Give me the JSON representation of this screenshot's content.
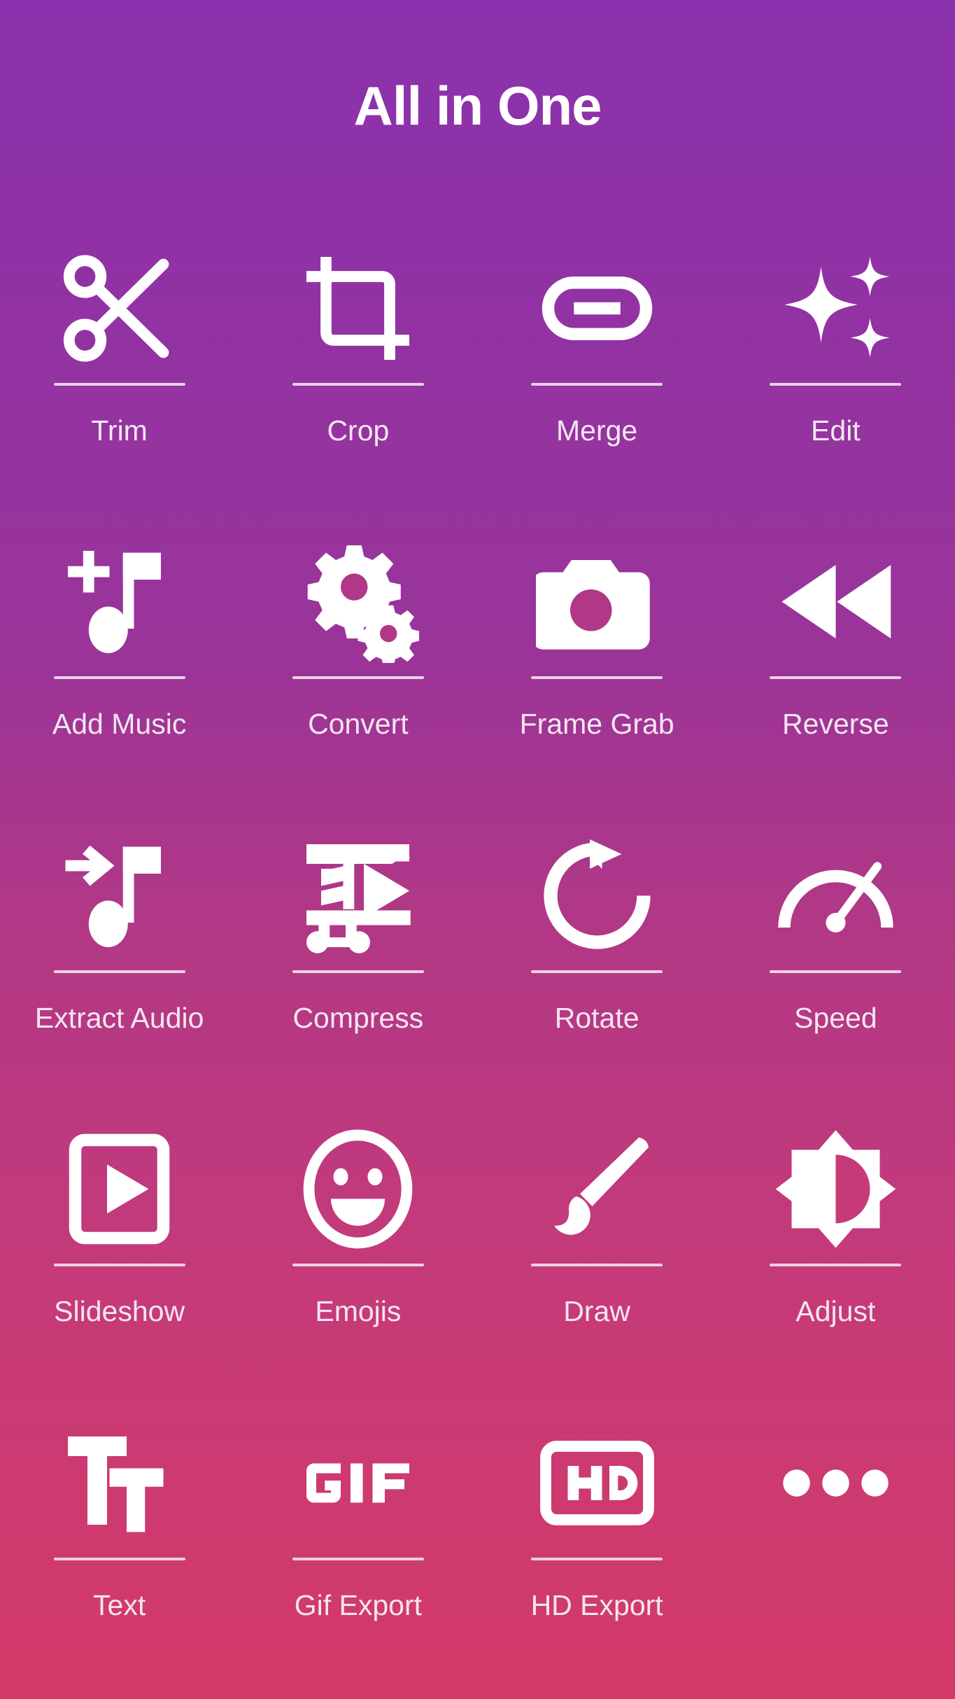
{
  "header": {
    "title": "All in One"
  },
  "theme": {
    "gradient_top": "#8a31ad",
    "gradient_bottom": "#d33a68",
    "icon_color": "#ffffff",
    "label_color": "#f4e6f1",
    "divider_color": "#ffffff"
  },
  "grid": {
    "columns": 4,
    "rows": 5,
    "items": [
      {
        "label": "Trim",
        "icon": "scissors-icon",
        "divider": true,
        "has_label": true
      },
      {
        "label": "Crop",
        "icon": "crop-icon",
        "divider": true,
        "has_label": true
      },
      {
        "label": "Merge",
        "icon": "link-chain-icon",
        "divider": true,
        "has_label": true
      },
      {
        "label": "Edit",
        "icon": "sparkles-icon",
        "divider": true,
        "has_label": true
      },
      {
        "label": "Add Music",
        "icon": "add-music-note-icon",
        "divider": true,
        "has_label": true
      },
      {
        "label": "Convert",
        "icon": "gears-icon",
        "divider": true,
        "has_label": true
      },
      {
        "label": "Frame Grab",
        "icon": "camera-icon",
        "divider": true,
        "has_label": true
      },
      {
        "label": "Reverse",
        "icon": "rewind-icon",
        "divider": true,
        "has_label": true
      },
      {
        "label": "Extract Audio",
        "icon": "extract-audio-icon",
        "divider": true,
        "has_label": true
      },
      {
        "label": "Compress",
        "icon": "compress-icon",
        "divider": true,
        "has_label": true
      },
      {
        "label": "Rotate",
        "icon": "rotate-icon",
        "divider": true,
        "has_label": true
      },
      {
        "label": "Speed",
        "icon": "speedometer-icon",
        "divider": true,
        "has_label": true
      },
      {
        "label": "Slideshow",
        "icon": "slideshow-icon",
        "divider": true,
        "has_label": true
      },
      {
        "label": "Emojis",
        "icon": "smiley-icon",
        "divider": true,
        "has_label": true
      },
      {
        "label": "Draw",
        "icon": "paintbrush-icon",
        "divider": true,
        "has_label": true
      },
      {
        "label": "Adjust",
        "icon": "brightness-icon",
        "divider": true,
        "has_label": true
      },
      {
        "label": "Text",
        "icon": "text-tt-icon",
        "divider": true,
        "has_label": true
      },
      {
        "label": "Gif Export",
        "icon": "gif-icon",
        "divider": true,
        "has_label": true
      },
      {
        "label": "HD Export",
        "icon": "hd-icon",
        "divider": true,
        "has_label": true
      },
      {
        "label": "",
        "icon": "more-dots-icon",
        "divider": false,
        "has_label": false
      }
    ]
  }
}
